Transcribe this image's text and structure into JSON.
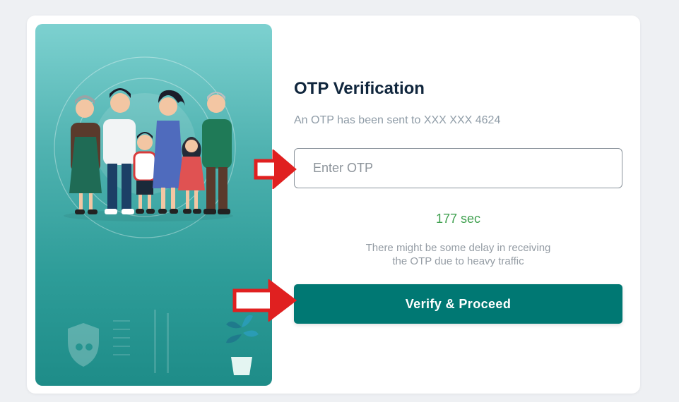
{
  "otp": {
    "title": "OTP Verification",
    "subtitle": "An OTP has been sent to XXX XXX 4624",
    "input_placeholder": "Enter OTP",
    "timer": "177 sec",
    "note_line1": "There might be some delay in receiving",
    "note_line2": "the OTP due to heavy traffic",
    "verify_label": "Verify & Proceed"
  },
  "colors": {
    "brand": "#007873",
    "timer": "#3fa04f",
    "annotation_arrow": "#e02020"
  },
  "illustration": {
    "icons": [
      "family-illustration",
      "shield-icon",
      "plant-icon"
    ]
  }
}
